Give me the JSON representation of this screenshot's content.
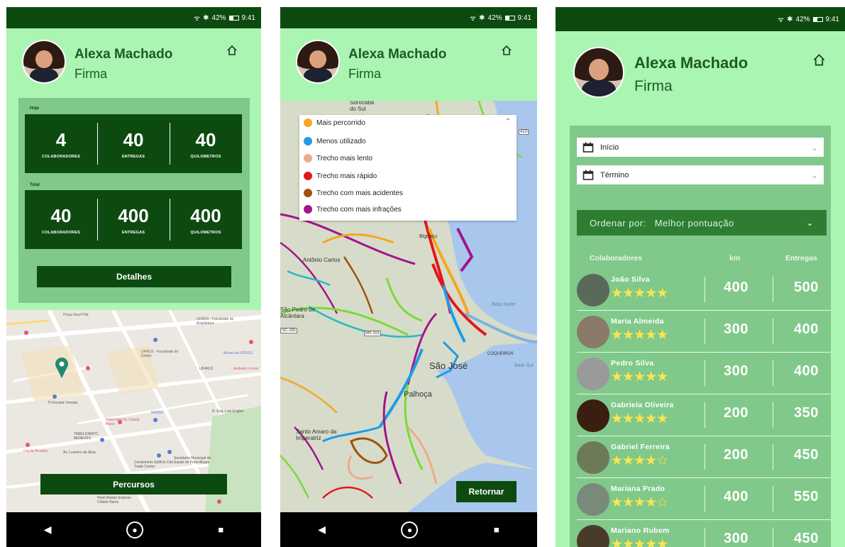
{
  "status": {
    "wifi": "ᯤ",
    "bluetooth": "✱",
    "battery_pct": "42%",
    "time": "9:41"
  },
  "profile": {
    "name": "Alexa Machado",
    "role": "Firma"
  },
  "dashboard": {
    "today_label": "Hoje",
    "total_label": "Total",
    "today": [
      {
        "value": "4",
        "label": "COLABORADORES"
      },
      {
        "value": "40",
        "label": "ENTREGAS"
      },
      {
        "value": "40",
        "label": "QUILOMETROS"
      }
    ],
    "total": [
      {
        "value": "40",
        "label": "COLABORADORES"
      },
      {
        "value": "400",
        "label": "ENTREGAS"
      },
      {
        "value": "400",
        "label": "QUILOMETROS"
      }
    ],
    "details_button": "Detalhes",
    "routes_button": "Percursos"
  },
  "map1_labels": {
    "praca": "Praça Raul Pilla",
    "ufrgs_arq": "UFRGS - Faculdade de Arquitetura",
    "ufrgs_dir": "UFRGS - Faculdade de Direito",
    "ufrgs": "UFRGS",
    "museu": "Museu da UFRGS",
    "andrade": "Andrade Lemos",
    "hotel": "Hotel Intercity Cidade Baixa",
    "tabeliona": "TABELIONATO MENEZES",
    "nerdz": "NERDZ",
    "condominio": "Condomínio Edifício Cão Trade Center",
    "secretaria": "Secretaria Municipal de Saúde de Porto Alegre",
    "piccina": "Cia da Picanha",
    "hotel_master": "Hotel Master Express Cidade Baixa",
    "eng": "R. Eng. Luiz Englert",
    "ri": "Tri Escolar Unespa",
    "leopoldo": "Av. Loureiro da Silva"
  },
  "map2": {
    "legend": [
      {
        "label": "Mais percorrido",
        "color": "#f5a623"
      },
      {
        "label": "Menos utilizado",
        "color": "#1e9be8"
      },
      {
        "label": "Trecho mais lento",
        "color": "#f0a98c"
      },
      {
        "label": "Trecho mais rápido",
        "color": "#e5161b"
      },
      {
        "label": "Trecho com mais acidentes",
        "color": "#a0520d"
      },
      {
        "label": "Trecho com mais infrações",
        "color": "#a3138c"
      }
    ],
    "place_labels": {
      "sorocaba": "Sorocaba do Sul",
      "antonio_carlos": "Antônio Carlos",
      "sao_pedro": "São Pedro de Alcântara",
      "baia_norte": "Baía Norte",
      "baia_sul": "Baía Sul",
      "coqueiros": "COQUEIROS",
      "sao_jose": "São José",
      "palhoca": "Palhoça",
      "santo_amaro": "Santo Amaro da Imperatriz",
      "sc281": "SC-281",
      "br101": "BR-101",
      "n10": "410",
      "biguacu": "Biguaçu"
    },
    "return_button": "Retornar"
  },
  "filters": {
    "start_label": "Início",
    "end_label": "Término",
    "sort_prefix": "Ordenar por:",
    "sort_value": "Melhor pontuação"
  },
  "table": {
    "headers": [
      "Colaboradores",
      "km",
      "Entregas"
    ],
    "rows": [
      {
        "name": "João Silva",
        "stars": "★★★★★",
        "km": "400",
        "entregas": "500"
      },
      {
        "name": "Maria Almeida",
        "stars": "★★★★★",
        "km": "300",
        "entregas": "400"
      },
      {
        "name": "Pedro Silva",
        "stars": "★★★★★",
        "km": "300",
        "entregas": "400"
      },
      {
        "name": "Gabriela Oliveira",
        "stars": "★★★★★",
        "km": "200",
        "entregas": "350"
      },
      {
        "name": "Gabriel Ferreira",
        "stars": "★★★★☆",
        "km": "200",
        "entregas": "450"
      },
      {
        "name": "Mariana Prado",
        "stars": "★★★★☆",
        "km": "400",
        "entregas": "550"
      },
      {
        "name": "Mariano Rubem",
        "stars": "★★★★★",
        "km": "300",
        "entregas": "450"
      }
    ]
  },
  "nav": {
    "back": "◀",
    "home": "●",
    "recent": "■"
  }
}
